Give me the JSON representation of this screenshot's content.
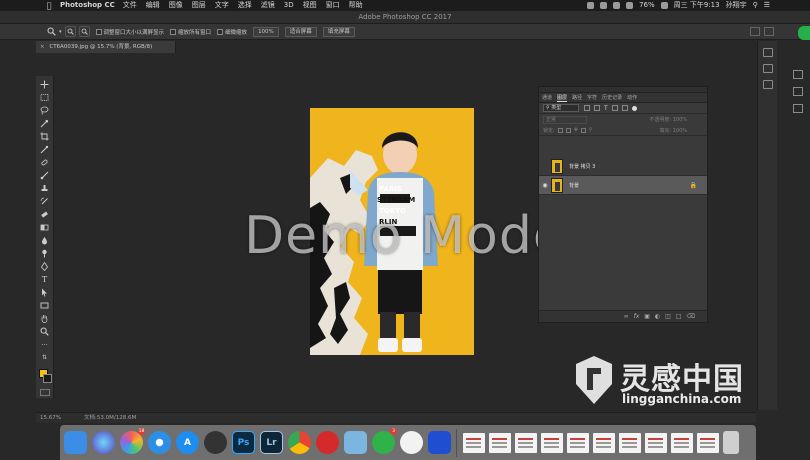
{
  "menubar": {
    "app_name": "Photoshop CC",
    "items": [
      "文件",
      "编辑",
      "图像",
      "图层",
      "文字",
      "选择",
      "滤镜",
      "3D",
      "视图",
      "窗口",
      "帮助"
    ],
    "battery": "76%",
    "clock": "周三 下午9:13",
    "user": "孙翔宇"
  },
  "window": {
    "title": "Adobe Photoshop CC 2017"
  },
  "options": {
    "resize_windows_label": "调整窗口大小以满屏显示",
    "zoom_all_label": "缩放所有窗口",
    "scrubby_zoom_label": "细微缩放",
    "zoom_value": "100%",
    "fit_screen_label": "适合屏幕",
    "fill_screen_label": "填充屏幕"
  },
  "document": {
    "tab_label": "CT6A0039.jpg @ 15.7% (背景, RGB/8)"
  },
  "canvas": {
    "overlay_text": "Demo Mode",
    "shirt_text": [
      "PARIS",
      "STERDAM",
      "TOKYO",
      "RLIN"
    ]
  },
  "layers_panel": {
    "tabs": [
      "通道",
      "图层",
      "路径",
      "字符",
      "历史记录",
      "动作"
    ],
    "active_tab": "图层",
    "filter_label": "类型",
    "blend_mode": "正常",
    "opacity_label": "不透明度:",
    "opacity_value": "100%",
    "lock_label": "锁定:",
    "fill_label": "填充:",
    "fill_value": "100%",
    "layers": [
      {
        "name": "背景 拷贝 3",
        "visible": false,
        "locked": false,
        "selected": false
      },
      {
        "name": "背景",
        "visible": true,
        "locked": true,
        "selected": true
      }
    ]
  },
  "status": {
    "zoom": "15.67%",
    "doc_size": "文档:53.0M/128.6M"
  },
  "dock": {
    "apps": [
      {
        "name": "finder",
        "color": "#3c8de6"
      },
      {
        "name": "siri",
        "color": "#5b3fb8"
      },
      {
        "name": "photos",
        "color": "#f0f0f0",
        "badge": "18"
      },
      {
        "name": "safari",
        "color": "#2b8fe8"
      },
      {
        "name": "app-store",
        "color": "#1d8ef0"
      },
      {
        "name": "quicktime",
        "color": "#333333"
      },
      {
        "name": "photoshop",
        "color": "#0b2a40",
        "label": "Ps"
      },
      {
        "name": "lightroom",
        "color": "#0e2636",
        "label": "Lr"
      },
      {
        "name": "chrome",
        "color": "#e9e9e9"
      },
      {
        "name": "netease-music",
        "color": "#d42a2a"
      },
      {
        "name": "preview",
        "color": "#7ab6e0"
      },
      {
        "name": "wechat",
        "color": "#2fb24a",
        "badge": "3"
      },
      {
        "name": "baidu-netdisk",
        "color": "#f2f2f2"
      },
      {
        "name": "photo-app",
        "color": "#1f4fd0"
      }
    ],
    "docs": 10
  },
  "watermark": {
    "cn": "灵感中国",
    "en": "lingganchina.com"
  }
}
